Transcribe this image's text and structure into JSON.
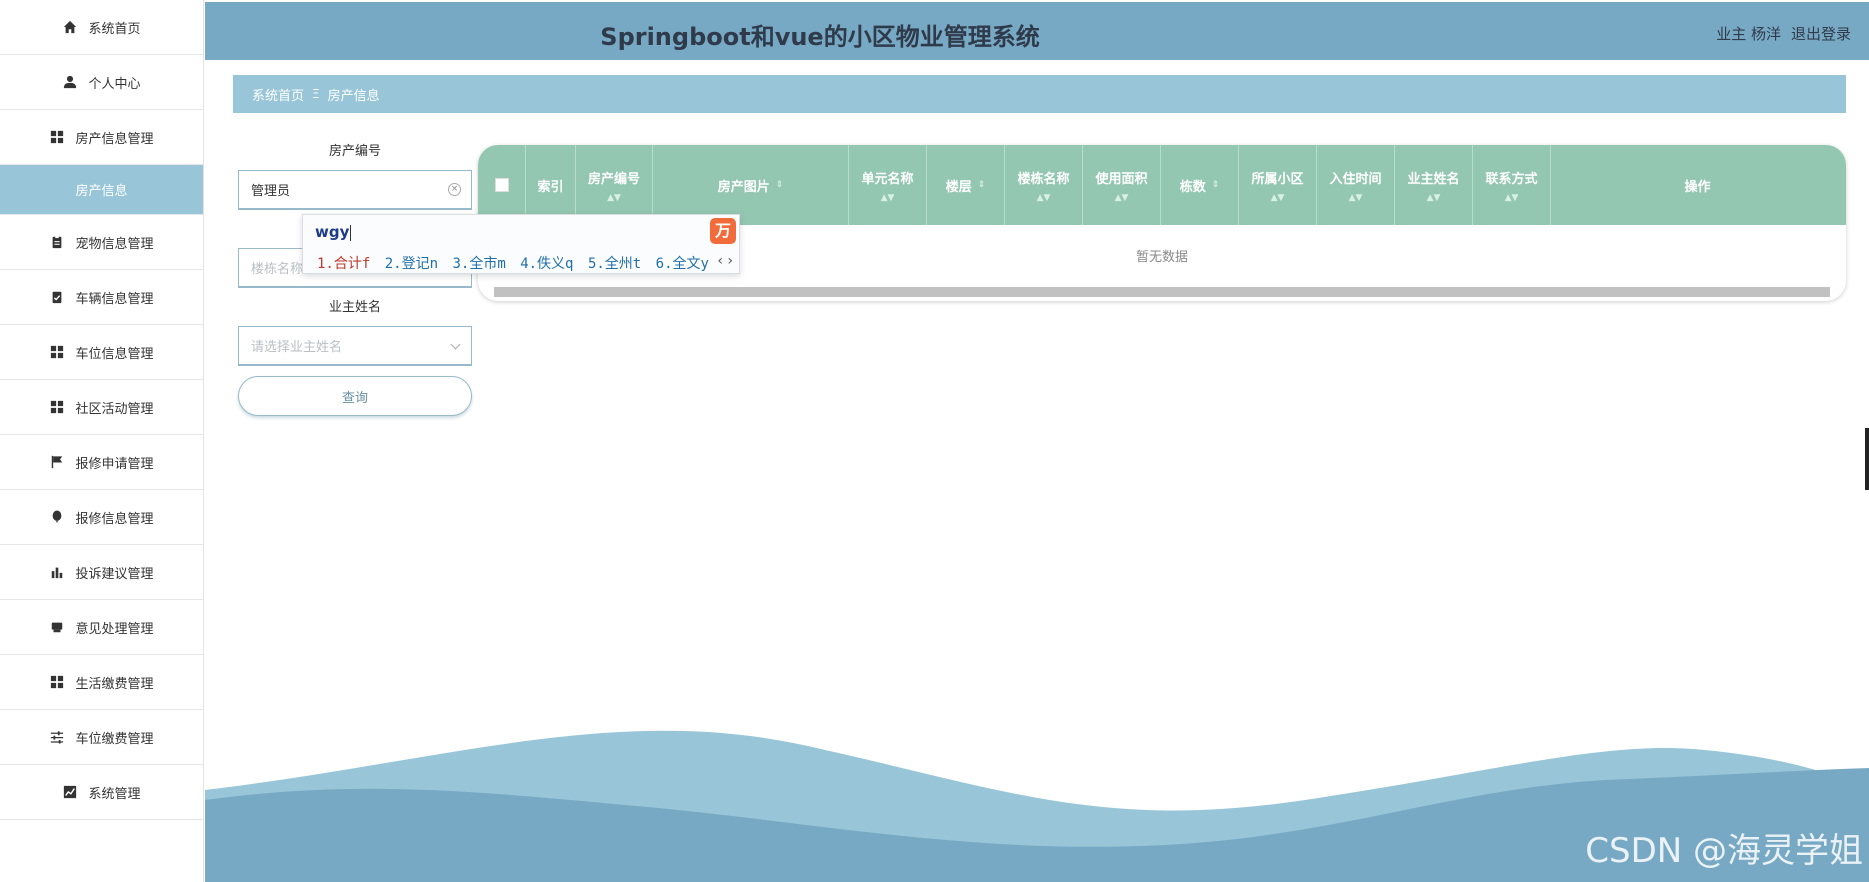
{
  "sidebar": {
    "items": [
      {
        "label": "系统首页",
        "icon": "home-icon"
      },
      {
        "label": "个人中心",
        "icon": "user-icon"
      },
      {
        "label": "房产信息管理",
        "icon": "grid-icon"
      },
      {
        "label": "房产信息",
        "icon": "",
        "active": true
      },
      {
        "label": "宠物信息管理",
        "icon": "clipboard-icon"
      },
      {
        "label": "车辆信息管理",
        "icon": "clipboard-check-icon"
      },
      {
        "label": "车位信息管理",
        "icon": "grid-icon"
      },
      {
        "label": "社区活动管理",
        "icon": "grid-icon"
      },
      {
        "label": "报修申请管理",
        "icon": "flag-icon"
      },
      {
        "label": "报修信息管理",
        "icon": "balloon-icon"
      },
      {
        "label": "投诉建议管理",
        "icon": "bar-chart-icon"
      },
      {
        "label": "意见处理管理",
        "icon": "printer-icon"
      },
      {
        "label": "生活缴费管理",
        "icon": "grid-icon"
      },
      {
        "label": "车位缴费管理",
        "icon": "sliders-icon"
      },
      {
        "label": "系统管理",
        "icon": "line-chart-icon"
      }
    ]
  },
  "header": {
    "title": "Springboot和vue的小区物业管理系统",
    "user_label": "业主 杨洋",
    "logout_label": "退出登录"
  },
  "breadcrumb": {
    "home": "系统首页",
    "separator": "Ξ",
    "current": "房产信息"
  },
  "search": {
    "house_no_label": "房产编号",
    "house_no_value": "管理员",
    "building_placeholder": "楼栋名称",
    "owner_label": "业主姓名",
    "owner_placeholder": "请选择业主姓名",
    "query_button": "查询"
  },
  "ime": {
    "composition": "wgy",
    "logo": "万",
    "candidates": [
      "1.合计f",
      "2.登记n",
      "3.全市m",
      "4.佚义q",
      "5.全州t",
      "6.全文y"
    ],
    "nav": "‹ ›"
  },
  "table": {
    "columns": [
      "索引",
      "房产编号",
      "房产图片",
      "单元名称",
      "楼层",
      "楼栋名称",
      "使用面积",
      "栋数",
      "所属小区",
      "入住时间",
      "业主姓名",
      "联系方式",
      "操作"
    ],
    "empty_text": "暂无数据"
  },
  "watermark": "CSDN @海灵学姐",
  "colors": {
    "header": "#77a9c4",
    "breadcrumb": "#98c6d8",
    "table_header": "#94c7b2",
    "wave_light": "#98c6d8",
    "wave_dark": "#77a9c4"
  }
}
